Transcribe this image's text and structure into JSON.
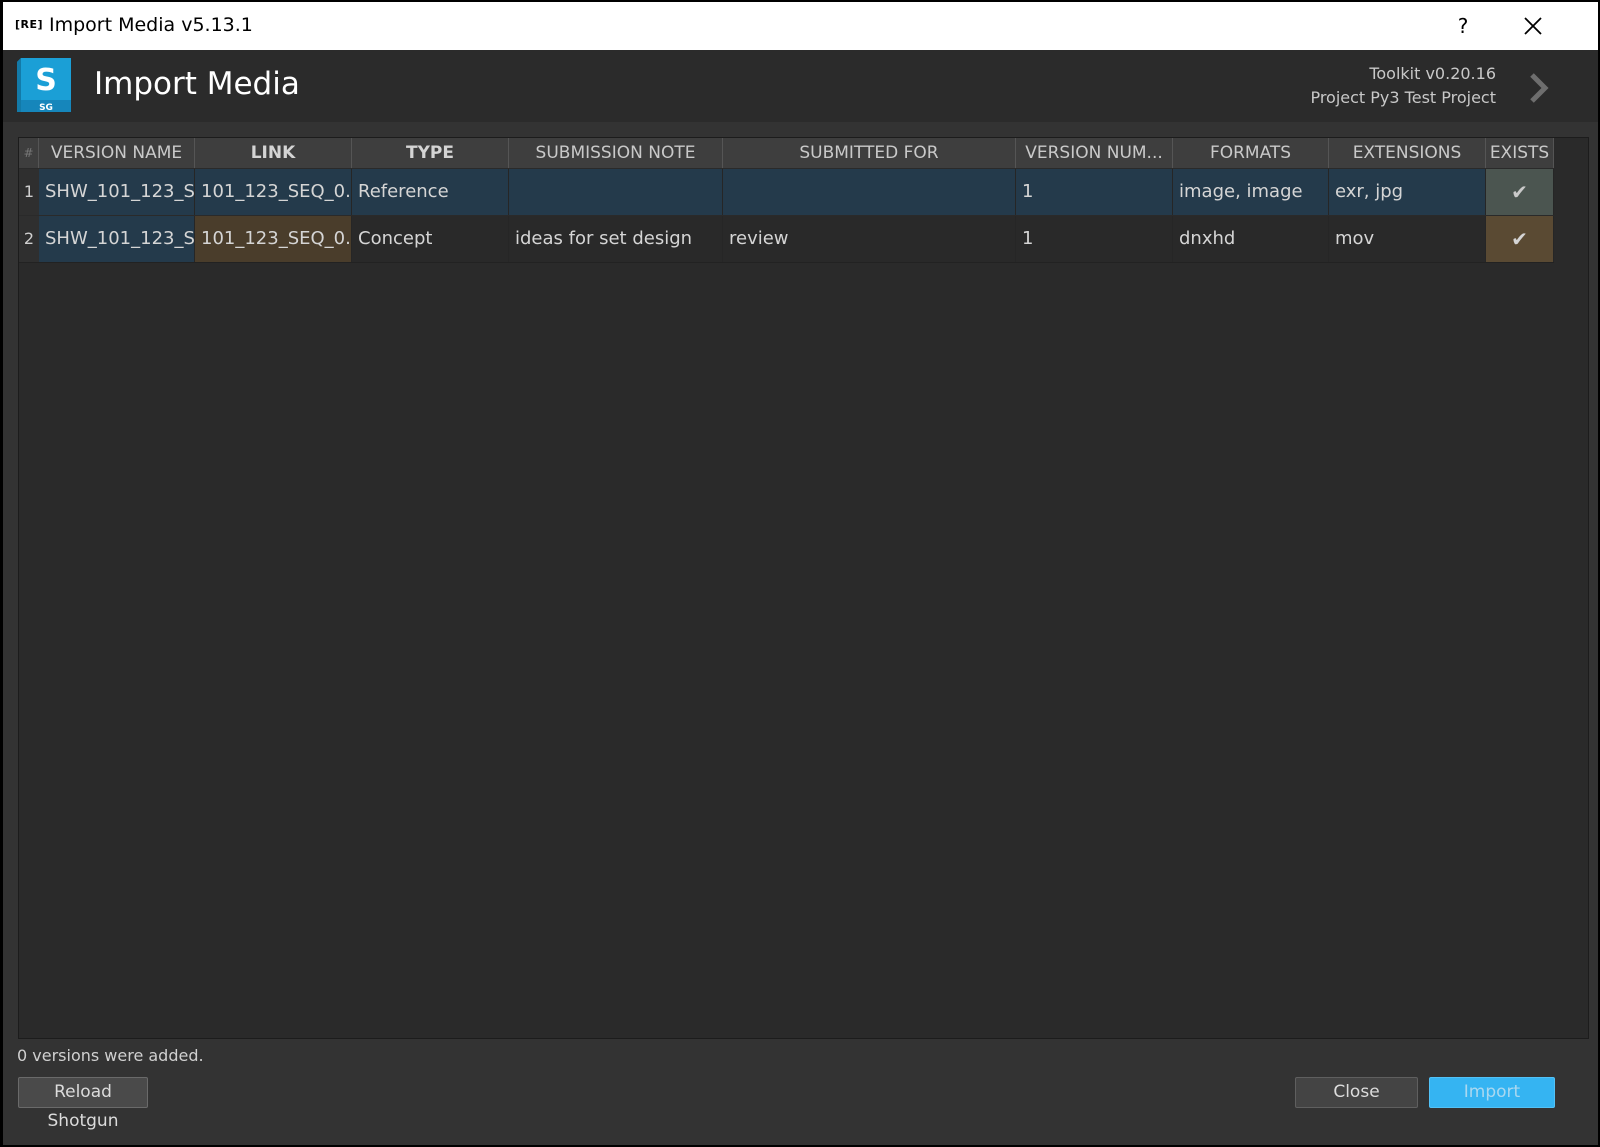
{
  "window": {
    "badge": "[RE]",
    "title": "Import Media v5.13.1",
    "help_label": "?"
  },
  "banner": {
    "logo_letter": "S",
    "logo_sub": "SG",
    "title": "Import Media",
    "toolkit_version": "Toolkit v0.20.16",
    "project": "Project Py3 Test Project"
  },
  "table": {
    "corner": "#",
    "headers": [
      "VERSION NAME",
      "LINK",
      "TYPE",
      "SUBMISSION NOTE",
      "SUBMITTED FOR",
      "VERSION NUM...",
      "FORMATS",
      "EXTENSIONS",
      "EXISTS"
    ],
    "rows": [
      {
        "num": "1",
        "version_name": "SHW_101_123_S...",
        "link": "101_123_SEQ_0...",
        "type": "Reference",
        "submission_note": "",
        "submitted_for": "",
        "version_number": "1",
        "formats": "image, image",
        "extensions": "exr, jpg",
        "exists": "✔"
      },
      {
        "num": "2",
        "version_name": "SHW_101_123_S...",
        "link": "101_123_SEQ_0...",
        "type": "Concept",
        "submission_note": "ideas for set design",
        "submitted_for": "review",
        "version_number": "1",
        "formats": "dnxhd",
        "extensions": "mov",
        "exists": "✔"
      }
    ]
  },
  "status_text": "0 versions were added.",
  "buttons": {
    "reload": "Reload Shotgun",
    "close": "Close",
    "import": "Import"
  },
  "colors": {
    "accent": "#35b4f2",
    "row1_bg": "#243a4b",
    "row2_link_bg": "#4a3d2b",
    "logo": "#1b9fd6"
  }
}
